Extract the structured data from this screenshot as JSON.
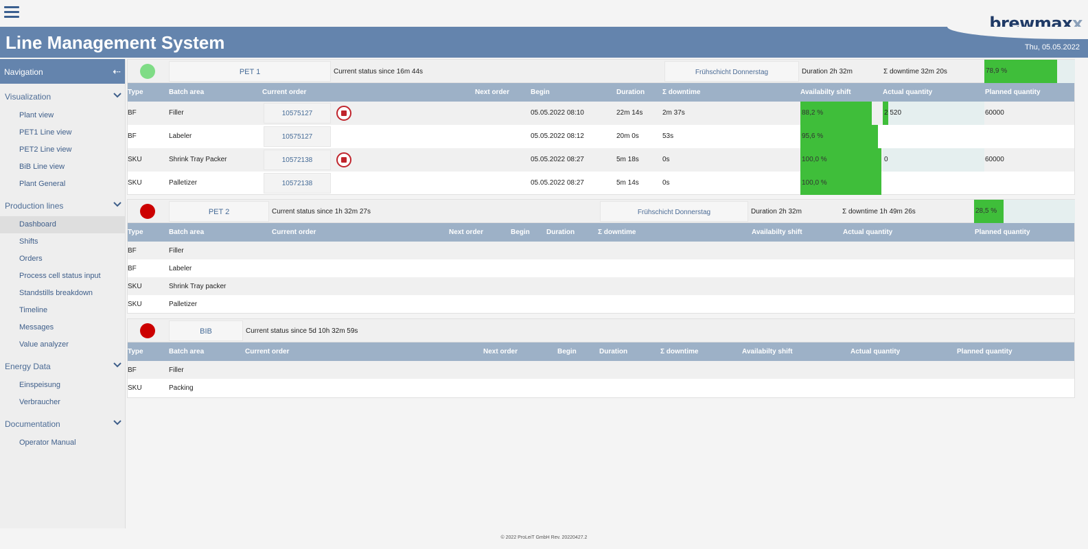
{
  "app": {
    "title": "Line Management System",
    "date": "Thu, 05.05.2022",
    "logo_main": "brewmax",
    "logo_x": "x"
  },
  "nav": {
    "title": "Navigation",
    "sections": [
      {
        "label": "Visualization",
        "items": [
          "Plant view",
          "PET1 Line view",
          "PET2 Line view",
          "BiB Line view",
          "Plant General"
        ]
      },
      {
        "label": "Production lines",
        "items": [
          "Dashboard",
          "Shifts",
          "Orders",
          "Process cell status input",
          "Standstills breakdown",
          "Timeline",
          "Messages",
          "Value analyzer"
        ],
        "active": "Dashboard"
      },
      {
        "label": "Energy Data",
        "items": [
          "Einspeisung",
          "Verbraucher"
        ]
      },
      {
        "label": "Documentation",
        "items": [
          "Operator Manual"
        ]
      }
    ]
  },
  "pet1": {
    "status_color": "#7fdc86",
    "name": "PET 1",
    "status": "Current status since 16m 44s",
    "shift": "Frühschicht Donnerstag",
    "duration": "Duration 2h 32m",
    "downtime": "Σ downtime 32m 20s",
    "availability": "78,9 %",
    "availability_value": 78.9,
    "columns": [
      "Type",
      "Batch area",
      "Current order",
      "Next order",
      "Begin",
      "Duration",
      "Σ downtime",
      "Availabilty shift",
      "Actual quantity",
      "Planned quantity"
    ],
    "rows": [
      {
        "type": "BF",
        "area": "Filler",
        "order": "10575127",
        "stop": true,
        "begin": "05.05.2022 08:10",
        "duration": "22m 14s",
        "downtime": "2m 37s",
        "avail": "88,2 %",
        "avail_value": 88.2,
        "actual": "2 520",
        "actual_value": 2520,
        "planned": "60000",
        "planned_value": 60000
      },
      {
        "type": "BF",
        "area": "Labeler",
        "order": "10575127",
        "stop": false,
        "begin": "05.05.2022 08:12",
        "duration": "20m 0s",
        "downtime": "53s",
        "avail": "95,6 %",
        "avail_value": 95.6,
        "actual": "",
        "planned": ""
      },
      {
        "type": "SKU",
        "area": "Shrink Tray Packer",
        "order": "10572138",
        "stop": true,
        "begin": "05.05.2022 08:27",
        "duration": "5m 18s",
        "downtime": "0s",
        "avail": "100,0 %",
        "avail_value": 100,
        "actual": "0",
        "actual_value": 0,
        "planned": "60000",
        "planned_value": 60000
      },
      {
        "type": "SKU",
        "area": "Palletizer",
        "order": "10572138",
        "stop": false,
        "begin": "05.05.2022 08:27",
        "duration": "5m 14s",
        "downtime": "0s",
        "avail": "100,0 %",
        "avail_value": 100,
        "actual": "",
        "planned": ""
      }
    ]
  },
  "pet2": {
    "status_color": "#cc0000",
    "name": "PET 2",
    "status": "Current status since 1h 32m 27s",
    "shift": "Frühschicht Donnerstag",
    "duration": "Duration 2h 32m",
    "downtime": "Σ downtime 1h 49m 26s",
    "availability": "28,5 %",
    "availability_value": 28.5,
    "columns": [
      "Type",
      "Batch area",
      "Current order",
      "Next order",
      "Begin",
      "Duration",
      "Σ downtime",
      "Availabilty shift",
      "Actual quantity",
      "Planned quantity"
    ],
    "rows": [
      {
        "type": "BF",
        "area": "Filler"
      },
      {
        "type": "BF",
        "area": "Labeler"
      },
      {
        "type": "SKU",
        "area": "Shrink Tray packer"
      },
      {
        "type": "SKU",
        "area": "Palletizer"
      }
    ]
  },
  "bib": {
    "status_color": "#cc0000",
    "name": "BIB",
    "status": "Current status since 5d 10h 32m 59s",
    "columns": [
      "Type",
      "Batch area",
      "Current order",
      "Next order",
      "Begin",
      "Duration",
      "Σ downtime",
      "Availabilty shift",
      "Actual quantity",
      "Planned quantity"
    ],
    "rows": [
      {
        "type": "BF",
        "area": "Filler"
      },
      {
        "type": "SKU",
        "area": "Packing"
      }
    ]
  },
  "footer": "© 2022 ProLeiT GmbH Rev. 20220427.2"
}
